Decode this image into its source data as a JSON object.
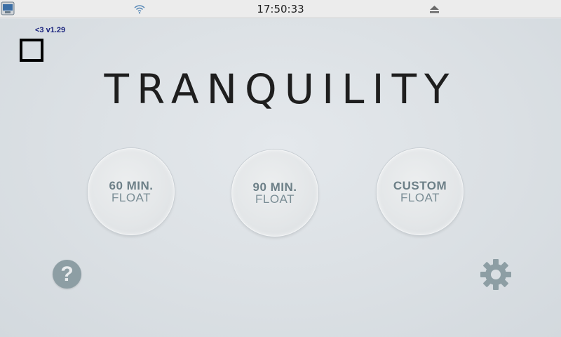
{
  "system_bar": {
    "clock": "17:50:33",
    "menu_icon": "raspberry-menu-icon",
    "wifi_icon": "wifi-icon",
    "eject_icon": "eject-icon"
  },
  "app": {
    "version": "<3 v1.29",
    "title": "TRANQUILITY",
    "buttons": [
      {
        "line1": "60 MIN.",
        "line2": "FLOAT"
      },
      {
        "line1": "90 MIN.",
        "line2": "FLOAT"
      },
      {
        "line1": "CUSTOM",
        "line2": "FLOAT"
      }
    ],
    "help_label": "?",
    "help_icon": "help-icon",
    "settings_icon": "gear-icon"
  },
  "colors": {
    "background": "#dde2e6",
    "button_text": "#6c7f87",
    "icon_gray": "#8d9ea4",
    "version_text": "#1a237e"
  }
}
